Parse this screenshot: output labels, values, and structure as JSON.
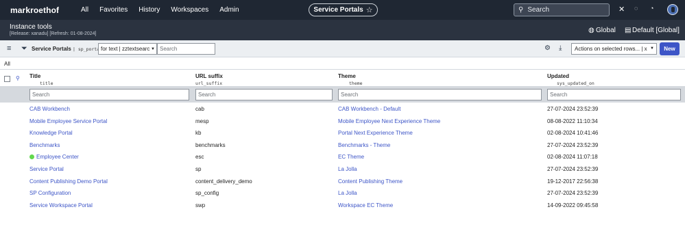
{
  "topnav": {
    "logo": "markroethof",
    "menu": [
      "All",
      "Favorites",
      "History",
      "Workspaces",
      "Admin"
    ],
    "context_pill": "Service Portals",
    "search_placeholder": "Search"
  },
  "context": {
    "title": "Instance tools",
    "subtitle": "[Release: xanadu] [Refresh: 01-08-2024]",
    "scope": "Global",
    "update_set": "Default [Global]"
  },
  "toolbar": {
    "list_title": "Service Portals",
    "table_name": "sp_portal",
    "search_field": "for text | zztextsearc",
    "search_placeholder": "Search",
    "actions_label": "Actions on selected rows... | x",
    "new_button": "New"
  },
  "breadcrumb": "All",
  "columns": [
    {
      "label": "Title",
      "field": "title"
    },
    {
      "label": "URL suffix",
      "field": "url_suffix"
    },
    {
      "label": "Theme",
      "field": "theme"
    },
    {
      "label": "Updated",
      "field": "sys_updated_on"
    }
  ],
  "column_search_placeholder": "Search",
  "rows": [
    {
      "title": "CAB Workbench",
      "url_suffix": "cab",
      "theme": "CAB Workbench - Default",
      "updated": "27-07-2024 23:52:39",
      "status_dot": false
    },
    {
      "title": "Mobile Employee Service Portal",
      "url_suffix": "mesp",
      "theme": "Mobile Employee Next Experience Theme",
      "updated": "08-08-2022 11:10:34",
      "status_dot": false
    },
    {
      "title": "Knowledge Portal",
      "url_suffix": "kb",
      "theme": "Portal Next Experience Theme",
      "updated": "02-08-2024 10:41:46",
      "status_dot": false
    },
    {
      "title": "Benchmarks",
      "url_suffix": "benchmarks",
      "theme": "Benchmarks - Theme",
      "updated": "27-07-2024 23:52:39",
      "status_dot": false
    },
    {
      "title": "Employee Center",
      "url_suffix": "esc",
      "theme": "EC Theme",
      "updated": "02-08-2024 11:07:18",
      "status_dot": true
    },
    {
      "title": "Service Portal",
      "url_suffix": "sp",
      "theme": "La Jolla",
      "updated": "27-07-2024 23:52:39",
      "status_dot": false
    },
    {
      "title": "Content Publishing Demo Portal",
      "url_suffix": "content_delivery_demo",
      "theme": "Content Publishing Theme",
      "updated": "19-12-2017 22:56:38",
      "status_dot": false
    },
    {
      "title": "SP Configuration",
      "url_suffix": "sp_config",
      "theme": "La Jolla",
      "updated": "27-07-2024 23:52:39",
      "status_dot": false
    },
    {
      "title": "Service Workspace Portal",
      "url_suffix": "swp",
      "theme": "Workspace EC Theme",
      "updated": "14-09-2022 09:45:58",
      "status_dot": false
    }
  ],
  "colors": {
    "topnav_bg": "#1f2733",
    "context_bg": "#2b3340",
    "link": "#3d55c7",
    "status_green": "#62d84e",
    "new_button": "#3d55c7"
  }
}
